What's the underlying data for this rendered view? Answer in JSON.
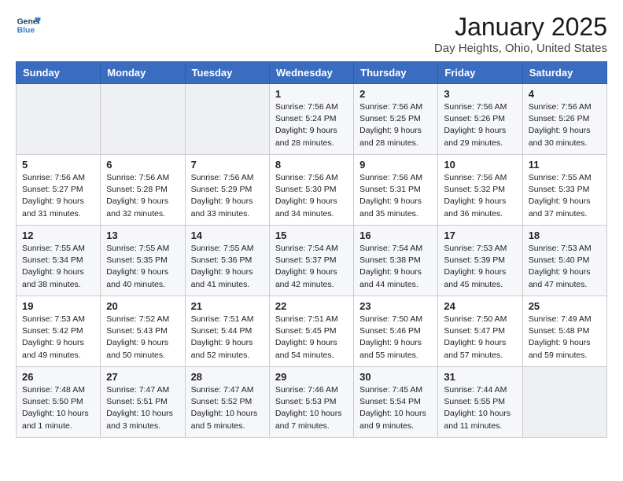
{
  "logo": {
    "name": "GeneralBlue",
    "line1": "General",
    "line2": "Blue"
  },
  "title": "January 2025",
  "subtitle": "Day Heights, Ohio, United States",
  "headers": [
    "Sunday",
    "Monday",
    "Tuesday",
    "Wednesday",
    "Thursday",
    "Friday",
    "Saturday"
  ],
  "weeks": [
    [
      {
        "day": "",
        "info": ""
      },
      {
        "day": "",
        "info": ""
      },
      {
        "day": "",
        "info": ""
      },
      {
        "day": "1",
        "info": "Sunrise: 7:56 AM\nSunset: 5:24 PM\nDaylight: 9 hours\nand 28 minutes."
      },
      {
        "day": "2",
        "info": "Sunrise: 7:56 AM\nSunset: 5:25 PM\nDaylight: 9 hours\nand 28 minutes."
      },
      {
        "day": "3",
        "info": "Sunrise: 7:56 AM\nSunset: 5:26 PM\nDaylight: 9 hours\nand 29 minutes."
      },
      {
        "day": "4",
        "info": "Sunrise: 7:56 AM\nSunset: 5:26 PM\nDaylight: 9 hours\nand 30 minutes."
      }
    ],
    [
      {
        "day": "5",
        "info": "Sunrise: 7:56 AM\nSunset: 5:27 PM\nDaylight: 9 hours\nand 31 minutes."
      },
      {
        "day": "6",
        "info": "Sunrise: 7:56 AM\nSunset: 5:28 PM\nDaylight: 9 hours\nand 32 minutes."
      },
      {
        "day": "7",
        "info": "Sunrise: 7:56 AM\nSunset: 5:29 PM\nDaylight: 9 hours\nand 33 minutes."
      },
      {
        "day": "8",
        "info": "Sunrise: 7:56 AM\nSunset: 5:30 PM\nDaylight: 9 hours\nand 34 minutes."
      },
      {
        "day": "9",
        "info": "Sunrise: 7:56 AM\nSunset: 5:31 PM\nDaylight: 9 hours\nand 35 minutes."
      },
      {
        "day": "10",
        "info": "Sunrise: 7:56 AM\nSunset: 5:32 PM\nDaylight: 9 hours\nand 36 minutes."
      },
      {
        "day": "11",
        "info": "Sunrise: 7:55 AM\nSunset: 5:33 PM\nDaylight: 9 hours\nand 37 minutes."
      }
    ],
    [
      {
        "day": "12",
        "info": "Sunrise: 7:55 AM\nSunset: 5:34 PM\nDaylight: 9 hours\nand 38 minutes."
      },
      {
        "day": "13",
        "info": "Sunrise: 7:55 AM\nSunset: 5:35 PM\nDaylight: 9 hours\nand 40 minutes."
      },
      {
        "day": "14",
        "info": "Sunrise: 7:55 AM\nSunset: 5:36 PM\nDaylight: 9 hours\nand 41 minutes."
      },
      {
        "day": "15",
        "info": "Sunrise: 7:54 AM\nSunset: 5:37 PM\nDaylight: 9 hours\nand 42 minutes."
      },
      {
        "day": "16",
        "info": "Sunrise: 7:54 AM\nSunset: 5:38 PM\nDaylight: 9 hours\nand 44 minutes."
      },
      {
        "day": "17",
        "info": "Sunrise: 7:53 AM\nSunset: 5:39 PM\nDaylight: 9 hours\nand 45 minutes."
      },
      {
        "day": "18",
        "info": "Sunrise: 7:53 AM\nSunset: 5:40 PM\nDaylight: 9 hours\nand 47 minutes."
      }
    ],
    [
      {
        "day": "19",
        "info": "Sunrise: 7:53 AM\nSunset: 5:42 PM\nDaylight: 9 hours\nand 49 minutes."
      },
      {
        "day": "20",
        "info": "Sunrise: 7:52 AM\nSunset: 5:43 PM\nDaylight: 9 hours\nand 50 minutes."
      },
      {
        "day": "21",
        "info": "Sunrise: 7:51 AM\nSunset: 5:44 PM\nDaylight: 9 hours\nand 52 minutes."
      },
      {
        "day": "22",
        "info": "Sunrise: 7:51 AM\nSunset: 5:45 PM\nDaylight: 9 hours\nand 54 minutes."
      },
      {
        "day": "23",
        "info": "Sunrise: 7:50 AM\nSunset: 5:46 PM\nDaylight: 9 hours\nand 55 minutes."
      },
      {
        "day": "24",
        "info": "Sunrise: 7:50 AM\nSunset: 5:47 PM\nDaylight: 9 hours\nand 57 minutes."
      },
      {
        "day": "25",
        "info": "Sunrise: 7:49 AM\nSunset: 5:48 PM\nDaylight: 9 hours\nand 59 minutes."
      }
    ],
    [
      {
        "day": "26",
        "info": "Sunrise: 7:48 AM\nSunset: 5:50 PM\nDaylight: 10 hours\nand 1 minute."
      },
      {
        "day": "27",
        "info": "Sunrise: 7:47 AM\nSunset: 5:51 PM\nDaylight: 10 hours\nand 3 minutes."
      },
      {
        "day": "28",
        "info": "Sunrise: 7:47 AM\nSunset: 5:52 PM\nDaylight: 10 hours\nand 5 minutes."
      },
      {
        "day": "29",
        "info": "Sunrise: 7:46 AM\nSunset: 5:53 PM\nDaylight: 10 hours\nand 7 minutes."
      },
      {
        "day": "30",
        "info": "Sunrise: 7:45 AM\nSunset: 5:54 PM\nDaylight: 10 hours\nand 9 minutes."
      },
      {
        "day": "31",
        "info": "Sunrise: 7:44 AM\nSunset: 5:55 PM\nDaylight: 10 hours\nand 11 minutes."
      },
      {
        "day": "",
        "info": ""
      }
    ]
  ]
}
